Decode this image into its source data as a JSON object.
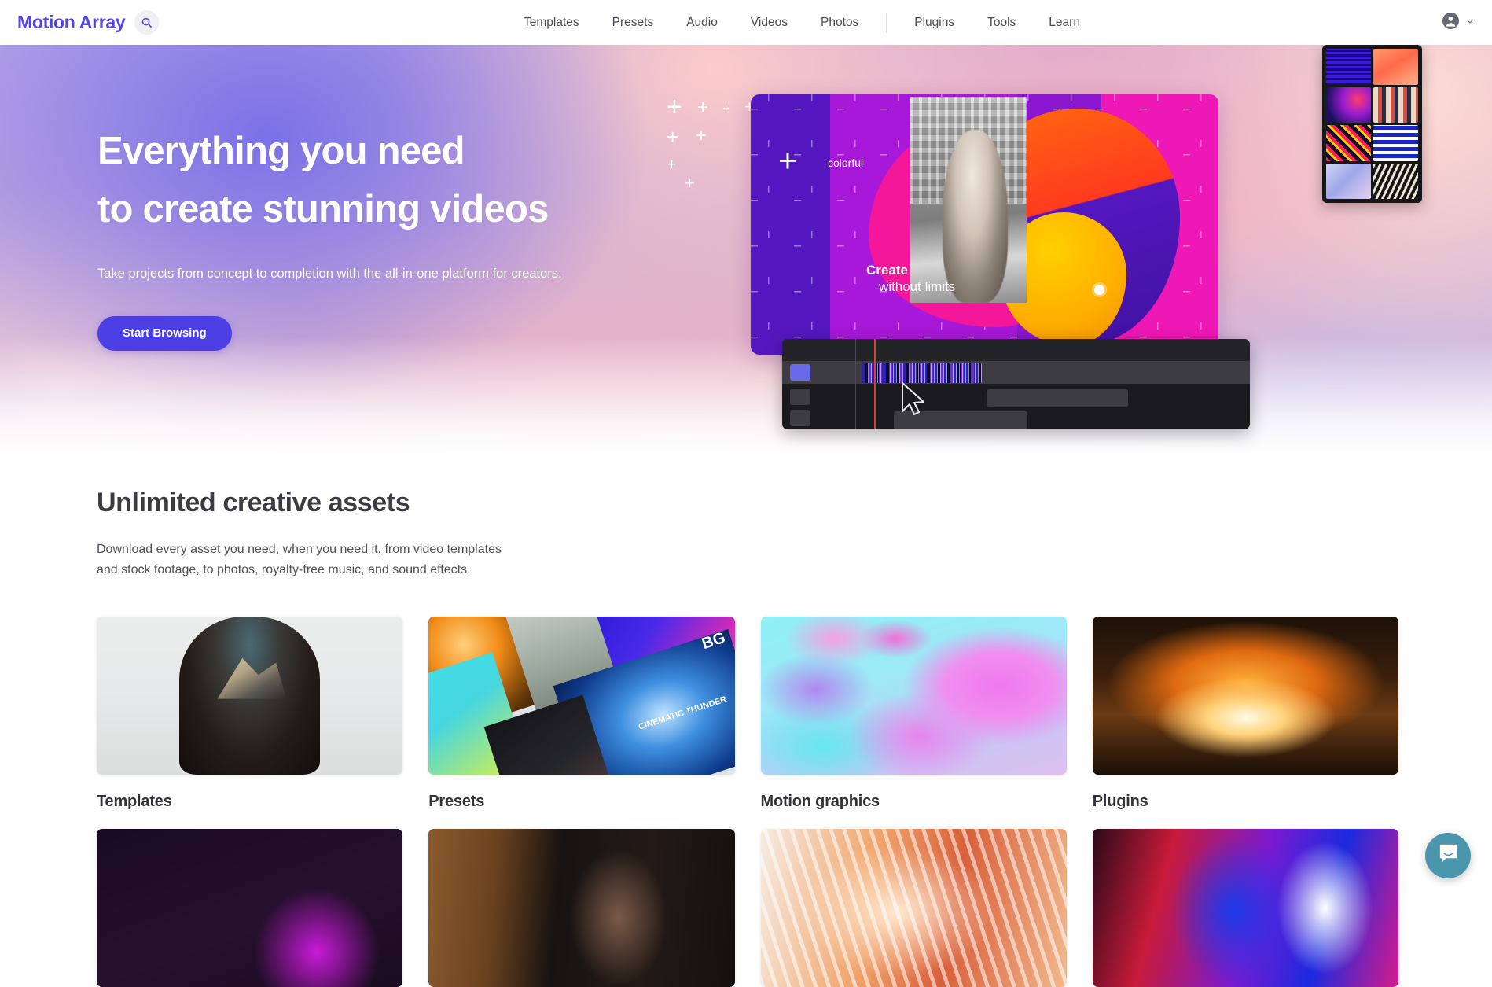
{
  "navbar": {
    "brand": "Motion Array",
    "search_icon": "search-icon",
    "links": [
      {
        "label": "Templates"
      },
      {
        "label": "Presets"
      },
      {
        "label": "Audio"
      },
      {
        "label": "Videos"
      },
      {
        "label": "Photos"
      }
    ],
    "links_secondary": [
      {
        "label": "Plugins"
      },
      {
        "label": "Tools"
      },
      {
        "label": "Learn"
      }
    ],
    "account_icon": "user-circle-icon",
    "account_chevron_icon": "chevron-down-icon",
    "brand_color": "#5145e5"
  },
  "hero": {
    "heading_line1": "Everything you need",
    "heading_line2": "to create stunning videos",
    "subheading": "Take projects from concept to completion with the all-in-one platform for creators.",
    "cta_label": "Start Browsing",
    "cta_color": "#4b3fe4",
    "art": {
      "label_colorful": "colorful",
      "label_create": "Create",
      "label_without_limits": "without limits",
      "preset_label_bg": "BG",
      "preset_label_cinema": "CINEMATIC THUNDER"
    }
  },
  "section": {
    "title": "Unlimited creative assets",
    "description_line1": "Download every asset you need, when you need it, from video templates",
    "description_line2": "and stock footage, to photos, royalty-free music, and sound effects.",
    "cards": [
      {
        "label": "Templates",
        "thumb": "th-templates"
      },
      {
        "label": "Presets",
        "thumb": "th-presets"
      },
      {
        "label": "Motion graphics",
        "thumb": "th-motion"
      },
      {
        "label": "Plugins",
        "thumb": "th-plugins"
      }
    ],
    "cards_row2": [
      {
        "thumb": "th-row2a"
      },
      {
        "thumb": "th-row2b"
      },
      {
        "thumb": "th-row2c"
      },
      {
        "thumb": "th-row2d"
      }
    ]
  },
  "chat": {
    "icon": "chat-bubble-icon",
    "color": "#4a97ad"
  }
}
